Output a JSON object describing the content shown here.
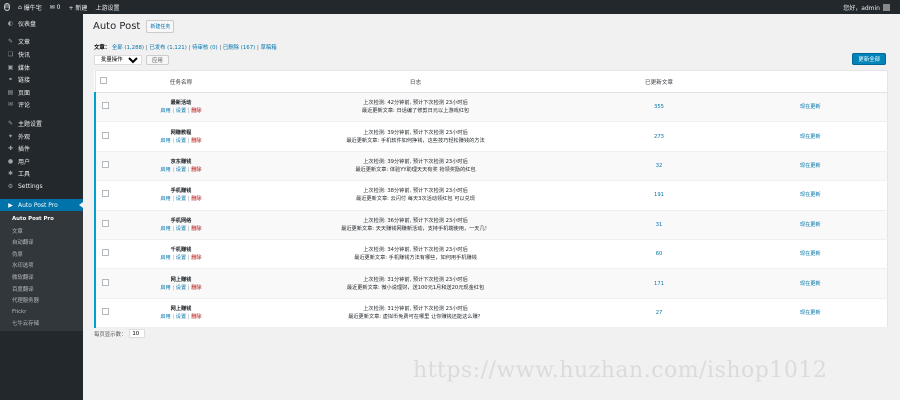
{
  "adminbar": {
    "site_name": "爆牛宅",
    "comments_count": "0",
    "new_label": "+ 新建",
    "plugin_label": "上游设置",
    "user_greeting": "您好，admin"
  },
  "sidebar": {
    "items": [
      {
        "label": "仪表盘",
        "icon": "◐"
      },
      {
        "label": "文章",
        "icon": "✎"
      },
      {
        "label": "快讯",
        "icon": "❏"
      },
      {
        "label": "媒体",
        "icon": "▣"
      },
      {
        "label": "链接",
        "icon": "⚭"
      },
      {
        "label": "页面",
        "icon": "▤"
      },
      {
        "label": "评论",
        "icon": "✉"
      },
      {
        "label": "主题设置",
        "icon": "✎"
      },
      {
        "label": "外观",
        "icon": "✦"
      },
      {
        "label": "插件",
        "icon": "✚"
      },
      {
        "label": "用户",
        "icon": "●"
      },
      {
        "label": "工具",
        "icon": "✱"
      },
      {
        "label": "Settings",
        "icon": "⚙"
      },
      {
        "label": "Auto Post Pro",
        "icon": "▶"
      }
    ],
    "submenu": [
      "Auto Post Pro",
      "文章",
      "自动翻译",
      "伪原",
      "水印选项",
      "微软翻译",
      "百度翻译",
      "代理服务器",
      "Flickr",
      "七牛云存储"
    ]
  },
  "main": {
    "title": "Auto Post",
    "add_new_label": "新建任务",
    "filters_prefix": "文章：",
    "filters": [
      {
        "label": "全部 (1,288)"
      },
      {
        "label": "已发布 (1,121)"
      },
      {
        "label": "待审核 (0)"
      },
      {
        "label": "已删除 (167)"
      },
      {
        "label": "草稿箱"
      }
    ],
    "bulk_select": "批量操作",
    "apply_label": "应用",
    "primary_button": "更新全部",
    "columns": [
      "任务名称",
      "日志",
      "已更新文章",
      ""
    ],
    "rows": [
      {
        "name": "最新活动",
        "actions": [
          "启用",
          "设置",
          "删除"
        ],
        "log1": "上次检测: 42分钟前, 预计下次检测 23小时后",
        "log2": "最近更新文章: 日话编了修剪日元以上游戏红包",
        "count": "355",
        "update": "现在更新"
      },
      {
        "name": "网赚教程",
        "actions": [
          "启用",
          "设置",
          "删除"
        ],
        "log1": "上次检测: 39分钟前, 预计下次检测 23小时后",
        "log2": "最近更新文章: 手机软件如何挣钱，这些技巧轻松赚钱的方法",
        "count": "273",
        "update": "现在更新"
      },
      {
        "name": "京东赚钱",
        "actions": [
          "启用",
          "设置",
          "删除"
        ],
        "log1": "上次检测: 39分钟前, 预计下次检测 23小时后",
        "log2": "最近更新文章: 体验YY助理天天有奖 抢领奖励的红包",
        "count": "32",
        "update": "现在更新"
      },
      {
        "name": "手机赚钱",
        "actions": [
          "启用",
          "设置",
          "删除"
        ],
        "log1": "上次检测: 38分钟前, 预计下次检测 23小时后",
        "log2": "最近更新文章: 云闪付 每天3次活动领红包 可以兑现",
        "count": "191",
        "update": "现在更新"
      },
      {
        "name": "手机网络",
        "actions": [
          "启用",
          "设置",
          "删除"
        ],
        "log1": "上次检测: 36分钟前, 预计下次检测 23小时后",
        "log2": "最近更新文章: 天天赚钱网赚新活动，支持手机端使用，一天几！",
        "count": "31",
        "update": "现在更新"
      },
      {
        "name": "千机赚钱",
        "actions": [
          "启用",
          "设置",
          "删除"
        ],
        "log1": "上次检测: 34分钟前, 预计下次检测 23小时后",
        "log2": "最近更新文章: 手机赚钱方法有哪些，如何用手机赚钱",
        "count": "60",
        "update": "现在更新"
      },
      {
        "name": "网上赚钱",
        "actions": [
          "启用",
          "设置",
          "删除"
        ],
        "log1": "上次检测: 31分钟前, 预计下次检测 23小时后",
        "log2": "最近更新文章: 微小说理财，送100元1月和送20元现金红包",
        "count": "171",
        "update": "现在更新"
      },
      {
        "name": "网上赚钱",
        "actions": [
          "启用",
          "设置",
          "删除"
        ],
        "log1": "上次检测: 31分钟前, 预计下次检测 23小时后",
        "log2": "最近更新文章: 虚拟币免费可在哪里 让你赚钱还能这么赚？",
        "count": "27",
        "update": "现在更新"
      }
    ],
    "per_page_label": "每页显示数：",
    "per_page_value": "10"
  },
  "watermark": "https://www.huzhan.com/ishop1012"
}
